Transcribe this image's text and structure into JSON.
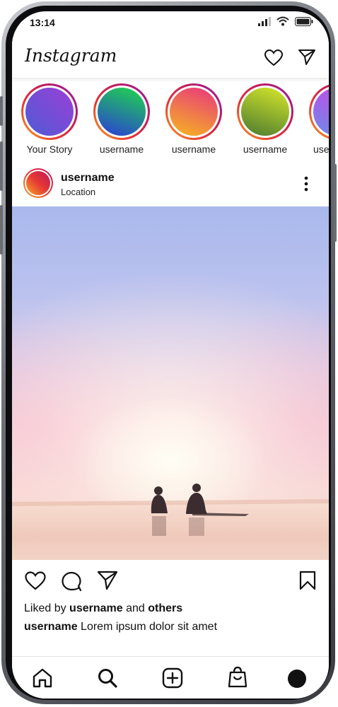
{
  "status_bar": {
    "time": "13:14",
    "icons": [
      "signal-icon",
      "wifi-icon",
      "battery-icon"
    ]
  },
  "header": {
    "logo": "Instagram",
    "icons": [
      "heart-icon",
      "direct-message-icon"
    ]
  },
  "stories": [
    {
      "label": "Your Story",
      "colors": [
        "#4f5bd5",
        "#9b3fd6"
      ]
    },
    {
      "label": "username",
      "colors": [
        "#1fd84a",
        "#2a3bd8"
      ]
    },
    {
      "label": "username",
      "colors": [
        "#e83580",
        "#f6b71e"
      ]
    },
    {
      "label": "username",
      "colors": [
        "#d8e82a",
        "#4a7a30"
      ]
    },
    {
      "label": "username",
      "colors": [
        "#c945e8",
        "#6e8be8"
      ]
    }
  ],
  "post": {
    "username": "username",
    "location": "Location",
    "liked_prefix": "Liked by",
    "liked_user": "username",
    "liked_and": "and",
    "liked_others": "others",
    "caption_user": "username",
    "caption_text": "Lorem ipsum dolor sit amet"
  },
  "bottom_nav": [
    "home-icon",
    "search-icon",
    "new-post-icon",
    "shop-icon",
    "profile-icon"
  ]
}
